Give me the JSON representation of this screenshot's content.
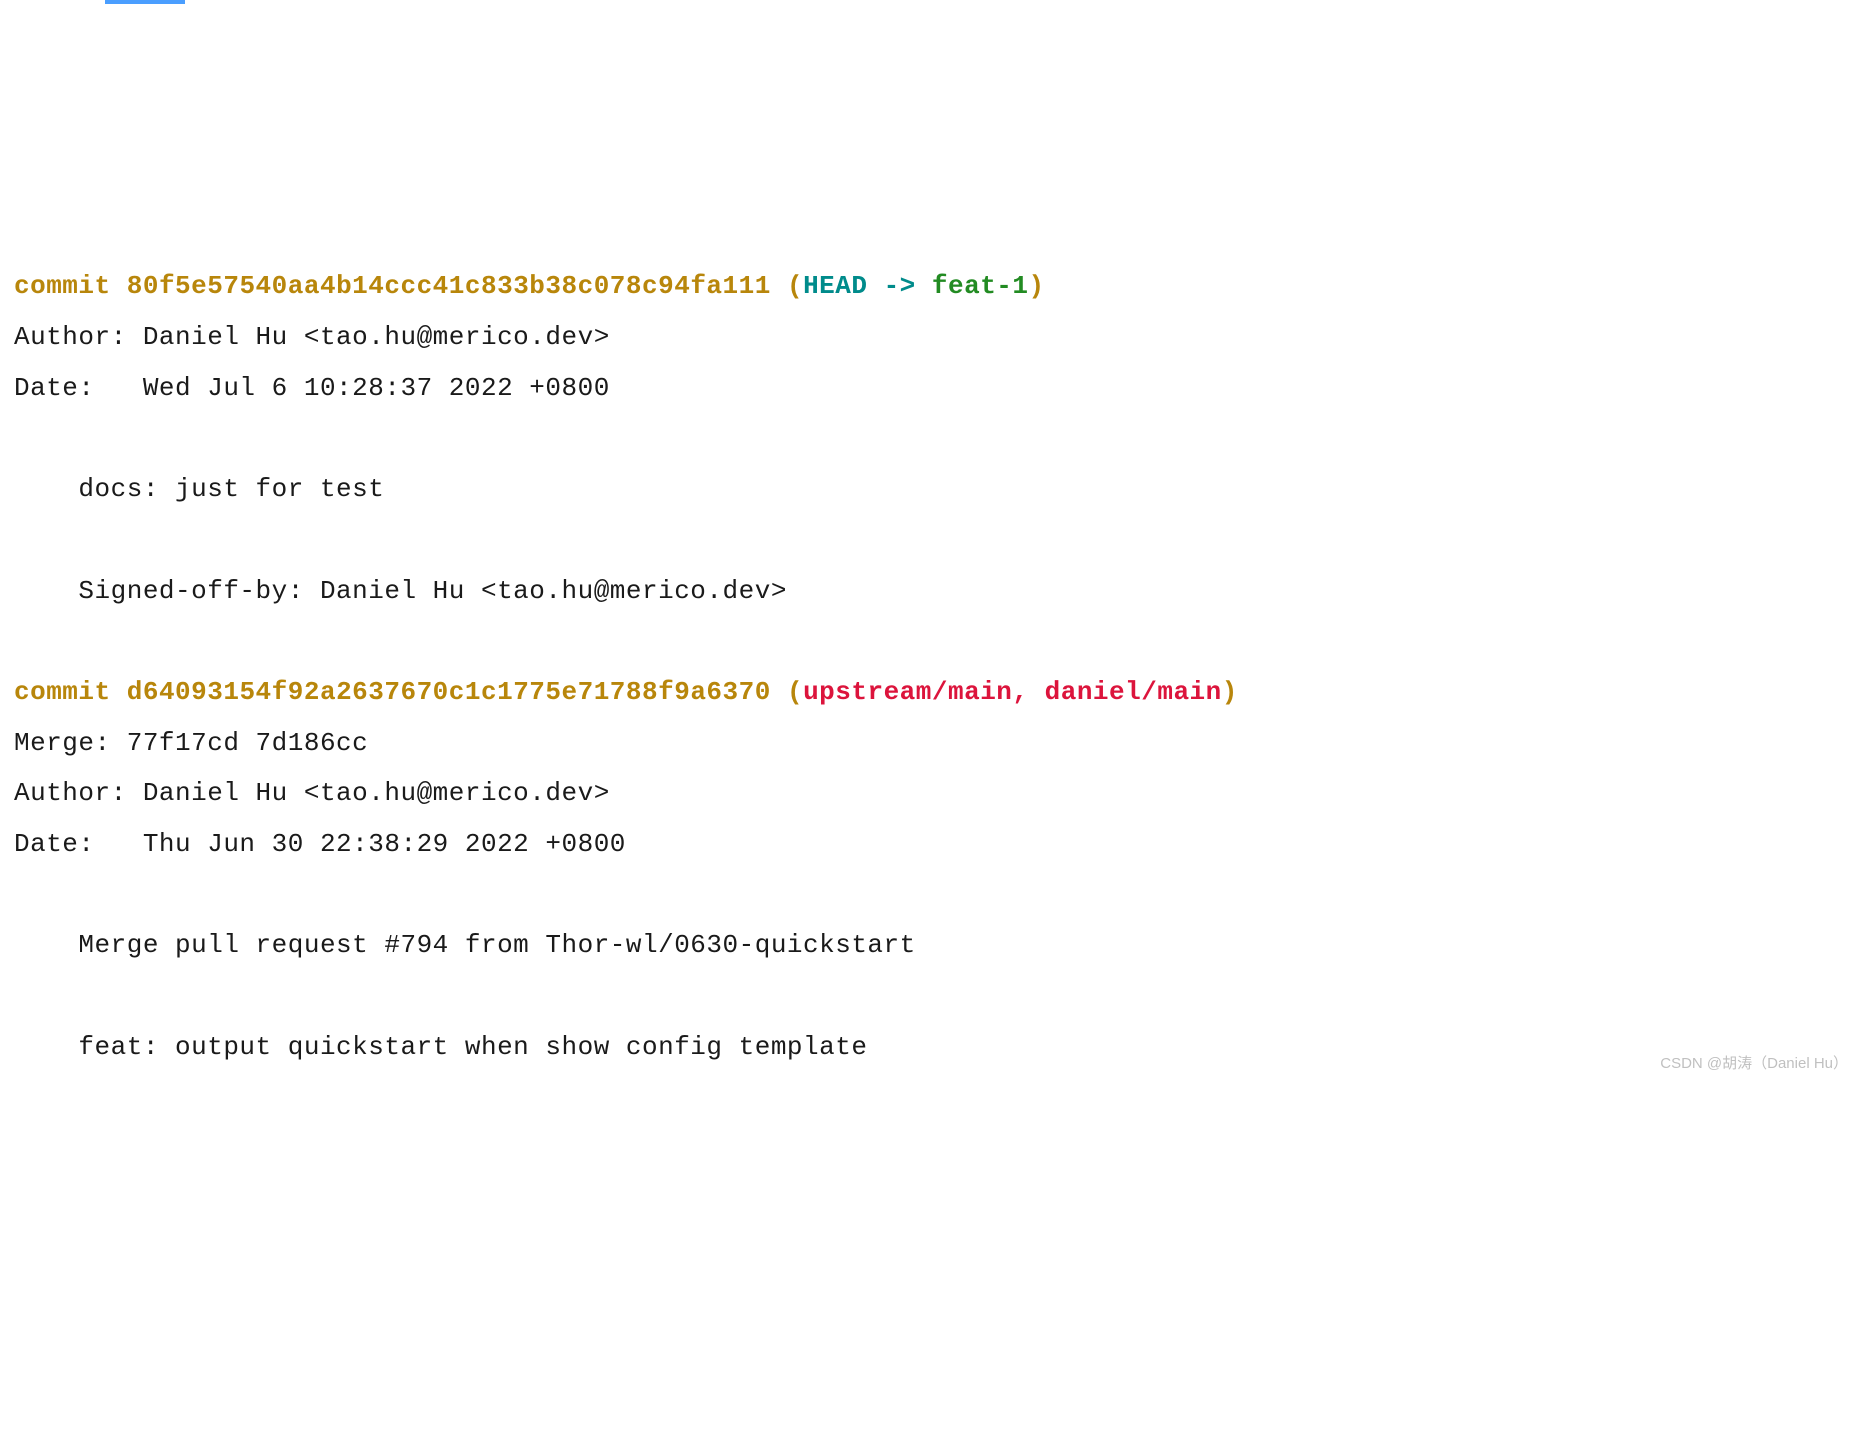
{
  "commits": [
    {
      "keyword": "commit",
      "hash": "80f5e57540aa4b14ccc41c833b38c078c94fa111",
      "refs": {
        "open_paren": " (",
        "head": "HEAD -> ",
        "branch": "feat-1",
        "close_paren": ")"
      },
      "author_line": "Author: Daniel Hu <tao.hu@merico.dev>",
      "date_line": "Date:   Wed Jul 6 10:28:37 2022 +0800",
      "body": [
        "    docs: just for test",
        "    ",
        "    Signed-off-by: Daniel Hu <tao.hu@merico.dev>"
      ]
    },
    {
      "keyword": "commit",
      "hash": "d64093154f92a2637670c1c1775e71788f9a6370",
      "refs": {
        "open_paren": " (",
        "remote1": "upstream/main",
        "sep": ", ",
        "remote2": "daniel/main",
        "close_paren": ")"
      },
      "merge_line": "Merge: 77f17cd 7d186cc",
      "author_line": "Author: Daniel Hu <tao.hu@merico.dev>",
      "date_line": "Date:   Thu Jun 30 22:38:29 2022 +0800",
      "body": [
        "    Merge pull request #794 from Thor-wl/0630-quickstart",
        "    ",
        "    feat: output quickstart when show config template"
      ]
    }
  ],
  "watermark": "CSDN @胡涛（Daniel Hu）"
}
